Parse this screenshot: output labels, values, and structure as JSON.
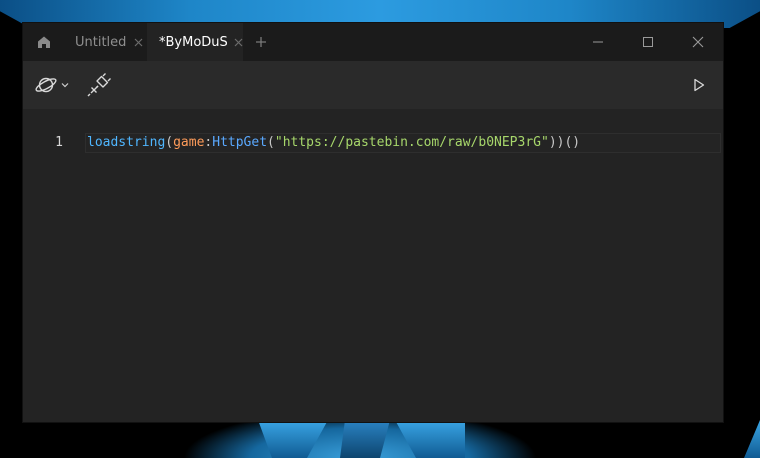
{
  "window": {
    "tabs": [
      {
        "label": "Untitled",
        "active": false
      },
      {
        "label": "*ByMoDuS",
        "active": true
      }
    ],
    "icons": {
      "home": "home-icon",
      "tab_close": "close-icon",
      "new_tab": "plus-icon",
      "minimize": "minimize-icon",
      "maximize": "maximize-icon",
      "close": "close-icon"
    }
  },
  "toolbar": {
    "icons": {
      "planet": "planet-icon",
      "dropdown": "chevron-down-icon",
      "attach": "plug-icon",
      "run": "play-icon"
    }
  },
  "editor": {
    "line_number": "1",
    "tokens": {
      "fn": "loadstring",
      "open1": "(",
      "global": "game",
      "colon": ":",
      "method": "HttpGet",
      "open2": "(",
      "string": "\"https://pastebin.com/raw/b0NEP3rG\"",
      "close": "))()"
    }
  },
  "colors": {
    "window_bg": "#232323",
    "titlebar_bg": "#1b1b1b",
    "toolbar_bg": "#2a2a2a",
    "function": "#4fb6ff",
    "global": "#ff9c5a",
    "method": "#5aa9ff",
    "string": "#a7d76b"
  }
}
